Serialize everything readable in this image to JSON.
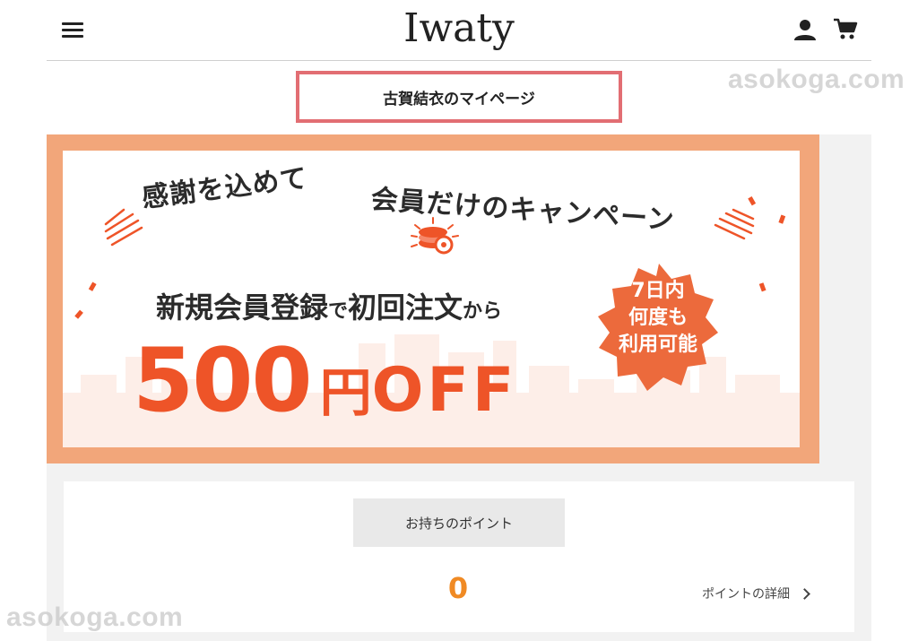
{
  "header": {
    "logo": "Iwaty",
    "menu_icon": "hamburger-menu-icon",
    "account_icon": "user-icon",
    "cart_icon": "shopping-cart-icon"
  },
  "watermark": "asokoga.com",
  "page_title": "古賀結衣のマイページ",
  "banner": {
    "tagline_left": "感謝を込めて",
    "tagline_right": "会員だけのキャンペーン",
    "line1_main_a": "新規会員登録",
    "line1_small_a": "で",
    "line1_main_b": "初回注文",
    "line1_small_b": "から",
    "offer_amount": "500",
    "offer_yen": "円",
    "offer_off": "OFF",
    "badge_line1": "7日内",
    "badge_line2": "何度も",
    "badge_line3": "利用可能",
    "colors": {
      "frame": "#f2a67a",
      "accent": "#ee5428",
      "badge": "#ec6a3c"
    }
  },
  "points": {
    "label": "お持ちのポイント",
    "value": "0",
    "detail_link": "ポイントの詳細"
  },
  "colors": {
    "title_border": "#e26e73",
    "points_value": "#f08a24",
    "panel_bg": "#f2f2f2"
  }
}
